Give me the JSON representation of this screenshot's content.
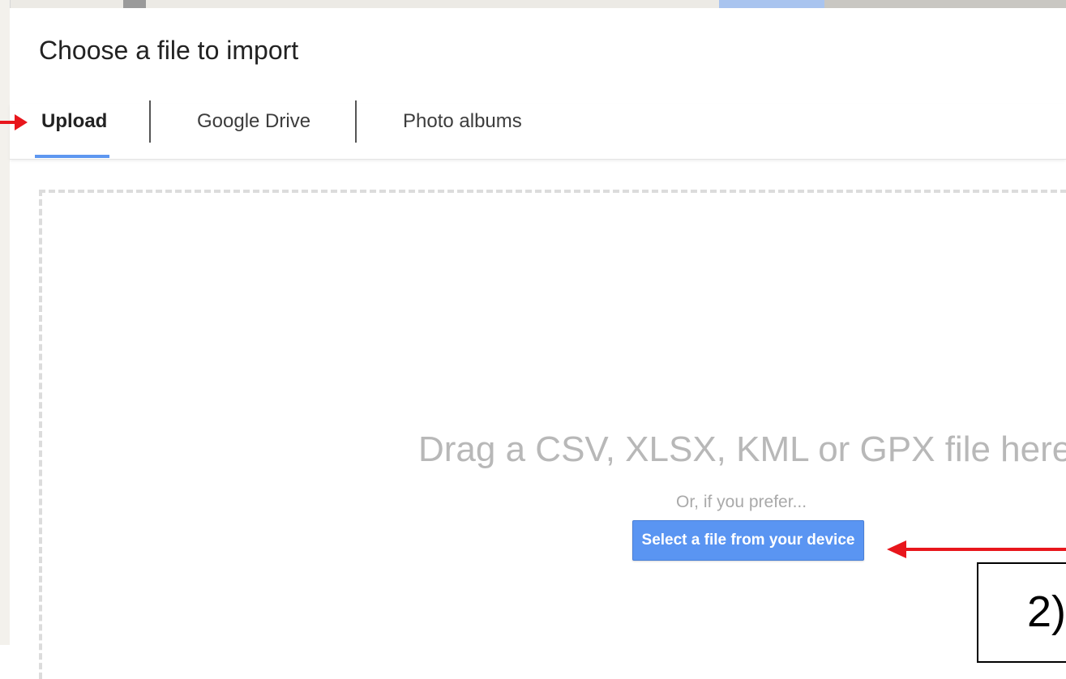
{
  "dialog": {
    "title": "Choose a file to import"
  },
  "tabs": [
    {
      "label": "Upload",
      "active": true
    },
    {
      "label": "Google Drive",
      "active": false
    },
    {
      "label": "Photo albums",
      "active": false
    }
  ],
  "dropzone": {
    "text": "Drag a CSV, XLSX, KML or GPX file here",
    "alt_text": "Or, if you prefer...",
    "button_label": "Select a file from your device"
  },
  "annotation": {
    "step_label": "2)"
  },
  "colors": {
    "accent": "#5a95f2",
    "arrow": "#e8161c"
  }
}
